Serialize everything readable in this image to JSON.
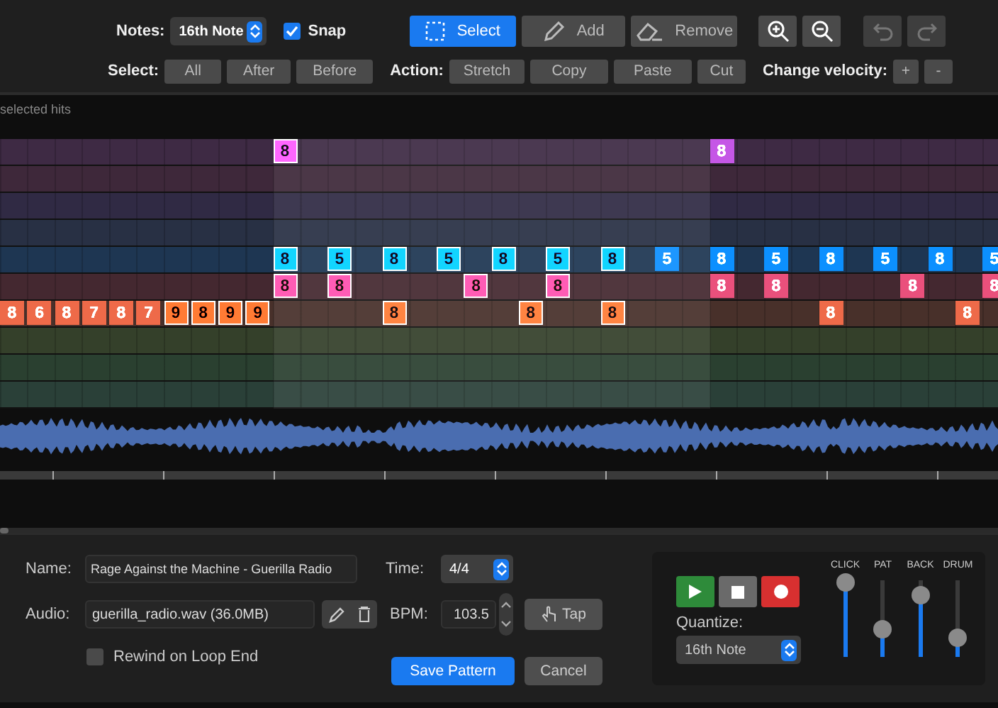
{
  "toolbar": {
    "notes_label": "Notes:",
    "notes_value": "16th Note",
    "snap": {
      "label": "Snap",
      "checked": true
    },
    "tools": [
      {
        "kind": "select",
        "label": "Select",
        "selected": true
      },
      {
        "kind": "pencil",
        "label": "Add",
        "selected": false
      },
      {
        "kind": "eraser",
        "label": "Remove",
        "selected": false
      }
    ],
    "view_buttons": [
      {
        "kind": "zoom-in",
        "disabled": false
      },
      {
        "kind": "zoom-out",
        "disabled": false
      },
      {
        "kind": "undo",
        "disabled": true
      },
      {
        "kind": "redo",
        "disabled": true
      }
    ],
    "groups": [
      {
        "label": "Select:",
        "buttons": [
          "All",
          "After",
          "Before"
        ]
      },
      {
        "label": "Action:",
        "buttons": [
          "Stretch",
          "Copy",
          "Paste",
          "Cut"
        ]
      },
      {
        "label": "Change velocity:",
        "buttons": [
          "+",
          "-"
        ]
      }
    ]
  },
  "status_text": "selected hits",
  "timeline": {
    "lanes": [
      {
        "color": "#3e2a44",
        "hits": [
          {
            "text": "8",
            "selected": true
          },
          {
            "text": "8",
            "selected": false
          }
        ]
      },
      {
        "color": "#3e283a"
      },
      {
        "color": "#302a44"
      },
      {
        "color": "#283044"
      },
      {
        "color": "#1e3652",
        "hits": [
          {
            "text": "8",
            "selected": true
          },
          {
            "text": "5",
            "selected": true
          },
          {
            "text": "8",
            "selected": true
          },
          {
            "text": "5",
            "selected": true
          },
          {
            "text": "8",
            "selected": true
          },
          {
            "text": "5",
            "selected": true
          },
          {
            "text": "8",
            "selected": true
          },
          {
            "text": "5",
            "selected": false
          },
          {
            "text": "8",
            "selected": false
          },
          {
            "text": "5",
            "selected": false
          },
          {
            "text": "8",
            "selected": false
          },
          {
            "text": "5",
            "selected": false
          },
          {
            "text": "8",
            "selected": false
          },
          {
            "text": "5",
            "selected": false
          }
        ]
      },
      {
        "color": "#442830",
        "hits": [
          {
            "text": "8",
            "selected": true
          },
          {
            "text": "8",
            "selected": true
          },
          {
            "text": "8",
            "selected": true
          },
          {
            "text": "8",
            "selected": true
          },
          {
            "text": "8",
            "selected": false
          },
          {
            "text": "8",
            "selected": false
          },
          {
            "text": "8",
            "selected": false
          },
          {
            "text": "8",
            "selected": false
          }
        ]
      },
      {
        "color": "#48302a",
        "hits": [
          {
            "text": "8",
            "selected": false
          },
          {
            "text": "6",
            "selected": false
          },
          {
            "text": "8",
            "selected": false
          },
          {
            "text": "7",
            "selected": false
          },
          {
            "text": "8",
            "selected": false
          },
          {
            "text": "7",
            "selected": false
          },
          {
            "text": "9",
            "selected": true
          },
          {
            "text": "8",
            "selected": true
          },
          {
            "text": "9",
            "selected": true
          },
          {
            "text": "9",
            "selected": true
          },
          {
            "text": "8",
            "selected": true
          },
          {
            "text": "8",
            "selected": true
          },
          {
            "text": "8",
            "selected": true
          },
          {
            "text": "8",
            "selected": false
          },
          {
            "text": "8",
            "selected": false
          }
        ]
      },
      {
        "color": "#34402a"
      },
      {
        "color": "#2a4030"
      },
      {
        "color": "#2a4038"
      }
    ]
  },
  "form": {
    "name_label": "Name:",
    "name_value": "Rage Against the Machine - Guerilla Radio",
    "audio_label": "Audio:",
    "audio_value": "guerilla_radio.wav (36.0MB)",
    "rewind": {
      "label": "Rewind on Loop End",
      "checked": false
    },
    "time_label": "Time:",
    "time_value": "4/4",
    "bpm_label": "BPM:",
    "bpm_value": "103.5",
    "tap_label": "Tap",
    "save_label": "Save Pattern",
    "cancel_label": "Cancel"
  },
  "transport": {
    "quantize_label": "Quantize:",
    "quantize_value": "16th Note",
    "faders": [
      {
        "label": "CLICK",
        "level": 0.97
      },
      {
        "label": "PAT",
        "level": 0.35
      },
      {
        "label": "BACK",
        "level": 0.8
      },
      {
        "label": "DRUM",
        "level": 0.25
      }
    ]
  }
}
